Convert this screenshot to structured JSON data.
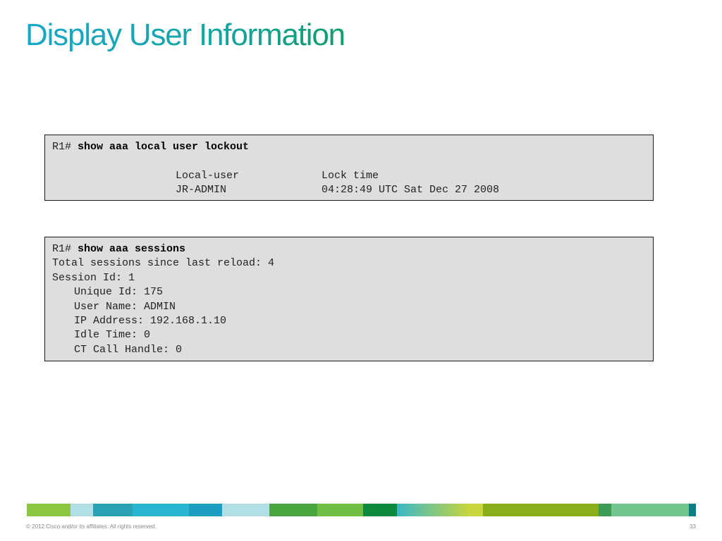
{
  "slide": {
    "title": "Display User Information"
  },
  "lockout_output": {
    "prompt": "R1# ",
    "command": "show aaa local user lockout",
    "header_user": "Local-user",
    "header_time": "Lock time",
    "row_user": "JR-ADMIN",
    "row_time": "04:28:49 UTC Sat Dec 27 2008"
  },
  "sessions_output": {
    "prompt": "R1# ",
    "command": "show aaa sessions",
    "lines": [
      "Total sessions since last reload: 4",
      "Session Id: 1"
    ],
    "indented_lines": [
      "Unique Id: 175",
      "User Name: ADMIN",
      "IP Address: 192.168.1.10",
      "Idle Time: 0",
      "CT Call Handle: 0"
    ]
  },
  "footer": {
    "copyright": "© 2012 Cisco and/or its affiliates. All rights reserved.",
    "page_number": "33"
  },
  "colors": {
    "title_gradient_start": "#1aa7c9",
    "title_gradient_end": "#0f9c6e",
    "cli_background": "#dedede",
    "footer_bar": [
      "#8dc63f",
      "#b2dfe6",
      "#29a3b4",
      "#2ab5d3",
      "#1b9ec0",
      "#b2dfe6",
      "#4aa63f",
      "#6fbf44",
      "#0e8a3f",
      "#3ab8c9",
      "#c8d53c",
      "#8aae1a",
      "#3c9b54",
      "#73c58e",
      "#0a7f86"
    ]
  }
}
